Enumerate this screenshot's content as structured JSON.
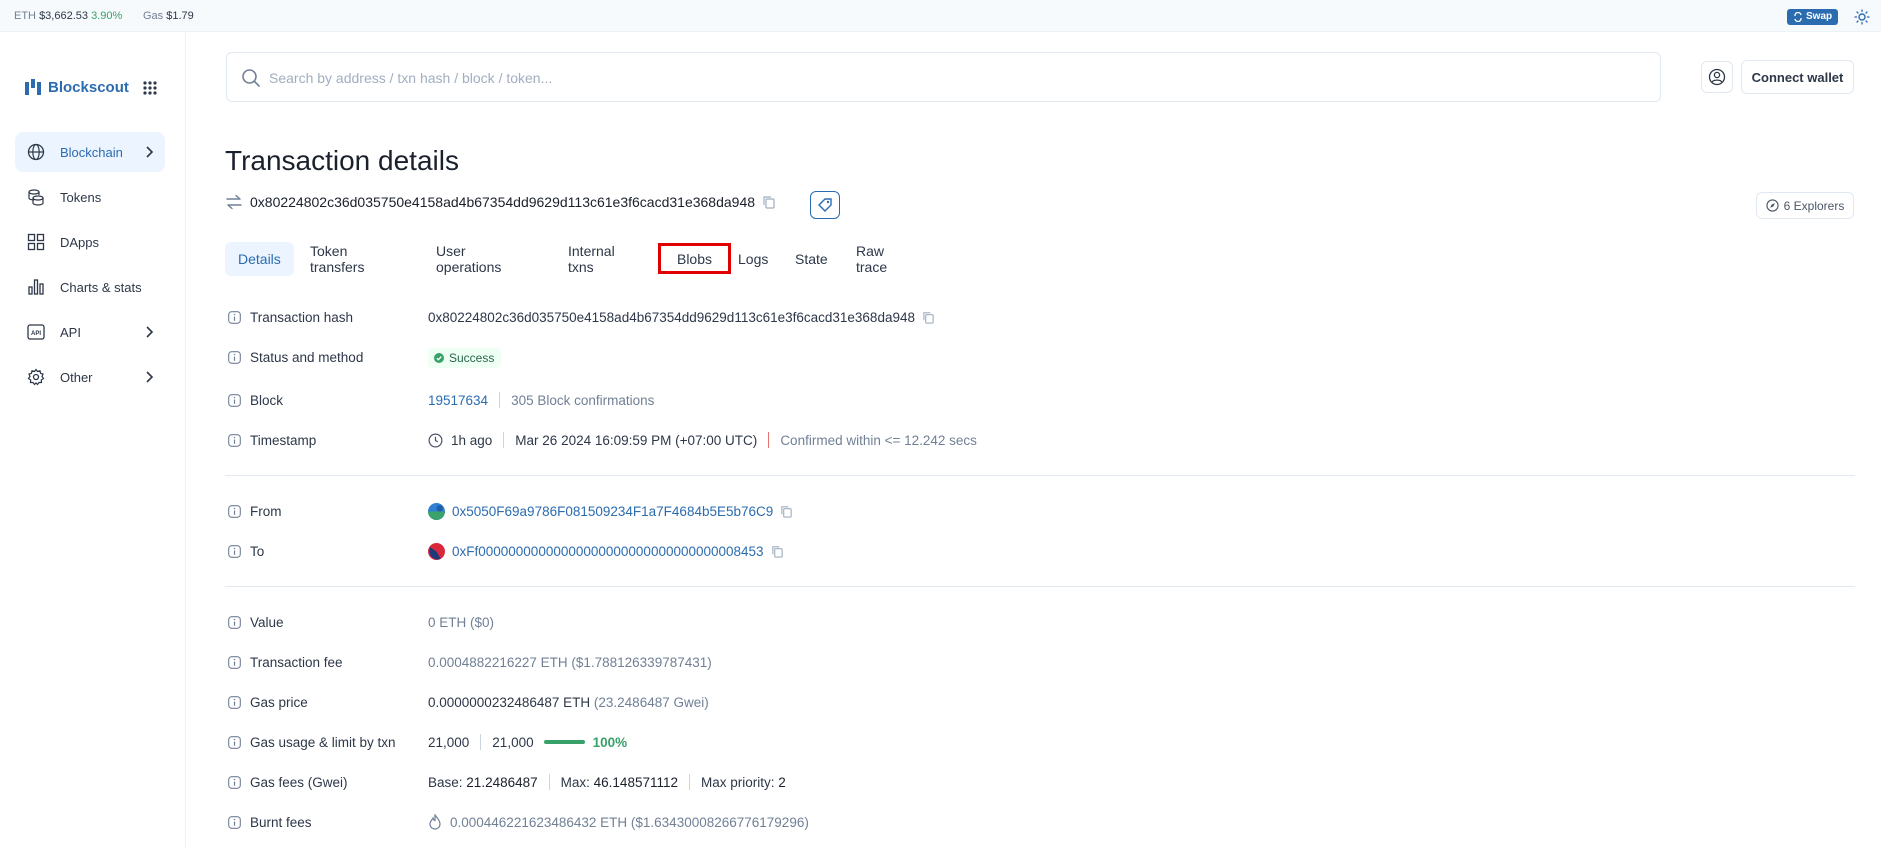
{
  "topbar": {
    "eth_label": "ETH",
    "eth_price": "$3,662.53",
    "eth_change": "3.90%",
    "gas_label": "Gas",
    "gas_price": "$1.79",
    "swap_label": "Swap"
  },
  "brand": {
    "name": "Blockscout"
  },
  "sidebar": {
    "items": [
      {
        "label": "Blockchain",
        "icon": "globe-icon",
        "has_chevron": true,
        "active": true
      },
      {
        "label": "Tokens",
        "icon": "coins-icon",
        "has_chevron": false
      },
      {
        "label": "DApps",
        "icon": "apps-grid-icon",
        "has_chevron": false
      },
      {
        "label": "Charts & stats",
        "icon": "chart-icon",
        "has_chevron": false
      },
      {
        "label": "API",
        "icon": "api-icon",
        "has_chevron": true
      },
      {
        "label": "Other",
        "icon": "gear-icon",
        "has_chevron": true
      }
    ]
  },
  "header": {
    "search_placeholder": "Search by address / txn hash / block / token...",
    "connect_wallet": "Connect wallet"
  },
  "page": {
    "title": "Transaction details",
    "tx_hash": "0x80224802c36d035750e4158ad4b67354dd9629d113c61e3f6cacd31e368da948",
    "explorers": "6 Explorers"
  },
  "tabs": [
    "Details",
    "Token transfers",
    "User operations",
    "Internal txns",
    "Blobs",
    "Logs",
    "State",
    "Raw trace"
  ],
  "details": {
    "tx_hash_label": "Transaction hash",
    "tx_hash_value": "0x80224802c36d035750e4158ad4b67354dd9629d113c61e3f6cacd31e368da948",
    "status_label": "Status and method",
    "status_value": "Success",
    "block_label": "Block",
    "block_number": "19517634",
    "block_confirmations": "305 Block confirmations",
    "timestamp_label": "Timestamp",
    "timestamp_ago": "1h ago",
    "timestamp_full": "Mar 26 2024 16:09:59 PM (+07:00 UTC)",
    "confirmed_within": "Confirmed within <= 12.242 secs",
    "from_label": "From",
    "from_address": "0x5050F69a9786F081509234F1a7F4684b5E5b76C9",
    "to_label": "To",
    "to_address": "0xFf00000000000000000000000000000000008453",
    "value_label": "Value",
    "value_value": "0 ETH ($0)",
    "fee_label": "Transaction fee",
    "fee_value": "0.0004882216227 ETH ($1.788126339787431)",
    "gas_price_label": "Gas price",
    "gas_price_eth": "0.0000000232486487 ETH",
    "gas_price_gwei": "(23.2486487 Gwei)",
    "gas_usage_label": "Gas usage & limit by txn",
    "gas_used": "21,000",
    "gas_limit": "21,000",
    "gas_usage_pct": "100%",
    "gas_usage_fraction": 1.0,
    "gas_fees_label": "Gas fees (Gwei)",
    "base_label": "Base:",
    "base_value": "21.2486487",
    "max_label": "Max:",
    "max_value": "46.148571112",
    "max_priority_label": "Max priority:",
    "max_priority_value": "2",
    "burnt_label": "Burnt fees",
    "burnt_value": "0.000446221623486432 ETH ($1.634300082667761792​96)"
  },
  "colors": {
    "accent": "#2b6cb0",
    "success": "#38a169",
    "highlight": "#e10000"
  }
}
